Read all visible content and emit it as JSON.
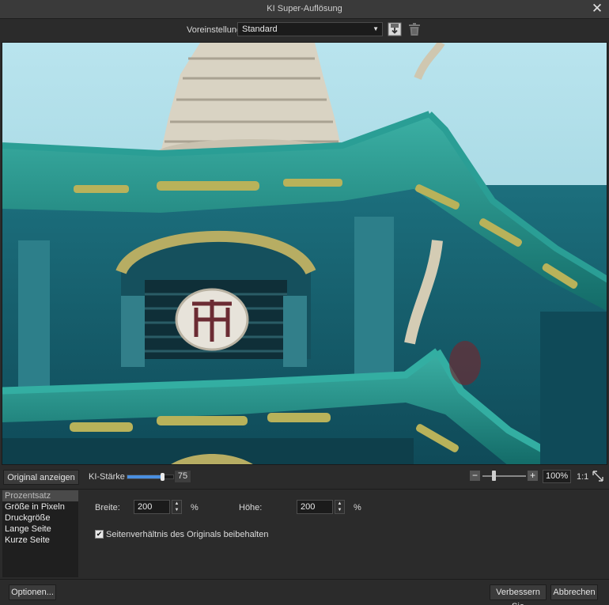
{
  "window": {
    "title": "KI Super-Auflösung",
    "close_glyph": "✕"
  },
  "preset": {
    "label": "Voreinstellung",
    "value": "Standard",
    "save_icon": "save-preset-icon",
    "delete_icon": "trash-icon"
  },
  "controls": {
    "show_original": "Original anzeigen",
    "ki_strength_label": "KI-Stärke",
    "ki_strength_value": "75",
    "ki_strength_fraction": 0.75,
    "zoom_value": "100%",
    "ratio_label": "1:1"
  },
  "sidebar": {
    "items": [
      {
        "label": "Prozentsatz",
        "selected": true
      },
      {
        "label": "Größe in Pixeln",
        "selected": false
      },
      {
        "label": "Druckgröße",
        "selected": false
      },
      {
        "label": "Lange Seite",
        "selected": false
      },
      {
        "label": "Kurze Seite",
        "selected": false
      }
    ]
  },
  "size": {
    "width_label": "Breite:",
    "width_value": "200",
    "height_label": "Höhe:",
    "height_value": "200",
    "unit": "%",
    "keep_ratio_label": "Seitenverhältnis des Originals beibehalten",
    "keep_ratio_checked": true
  },
  "footer": {
    "options": "Optionen...",
    "enhance": "Verbessern Sie",
    "cancel": "Abbrechen"
  },
  "colors": {
    "accent": "#4a8fe0",
    "sky": "#a8dbe6",
    "roof": "#1f8f86"
  }
}
